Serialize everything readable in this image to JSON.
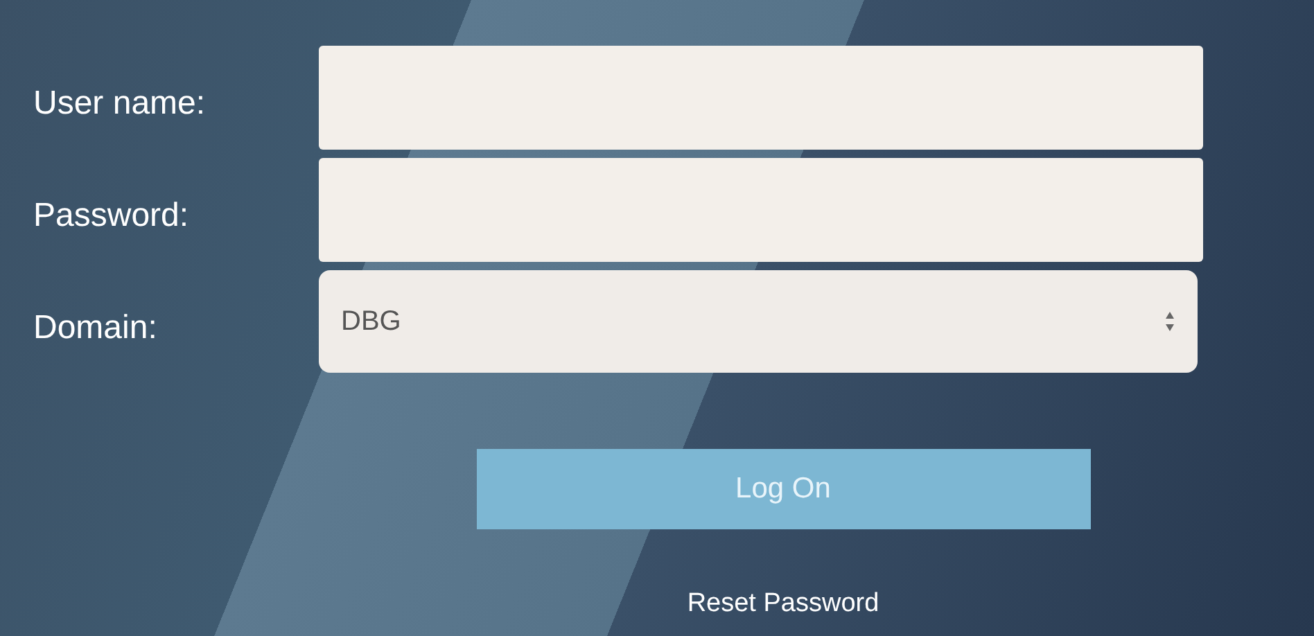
{
  "form": {
    "fields": [
      {
        "kind": "text",
        "label": "User name:"
      },
      {
        "kind": "password",
        "label": "Password:"
      },
      {
        "kind": "select",
        "label": "Domain:",
        "value": "DBG"
      }
    ]
  },
  "logon_button": "Log On",
  "reset_link": "Reset Password"
}
